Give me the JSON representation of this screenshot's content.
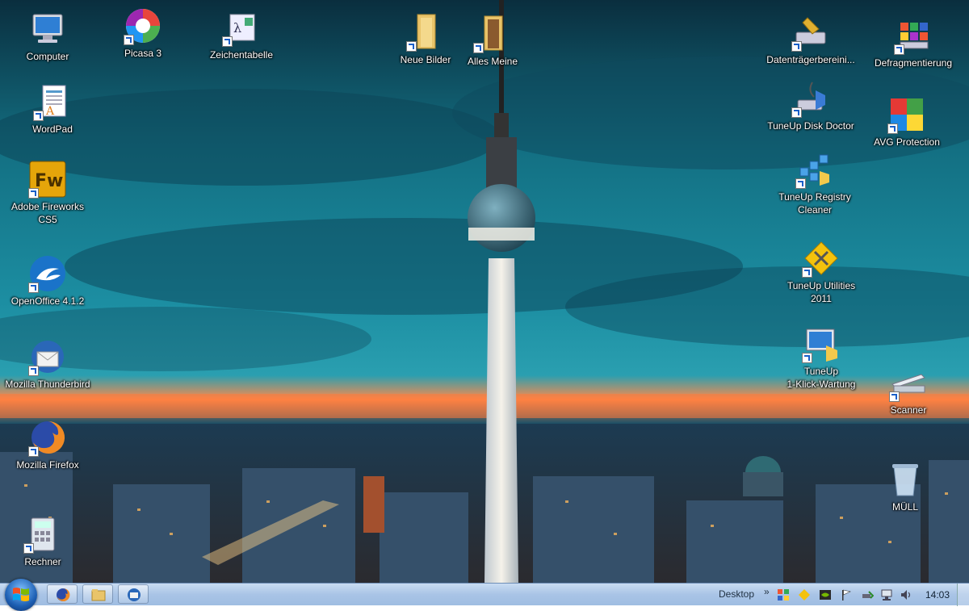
{
  "desktop": {
    "icons": [
      {
        "id": "computer",
        "label": "Computer"
      },
      {
        "id": "picasa",
        "label": "Picasa 3"
      },
      {
        "id": "zeichentabelle",
        "label": "Zeichentabelle"
      },
      {
        "id": "neue-bilder",
        "label": "Neue Bilder"
      },
      {
        "id": "alles-meine",
        "label": "Alles Meine"
      },
      {
        "id": "datentraeger",
        "label": "Datenträgerbereini..."
      },
      {
        "id": "defrag",
        "label": "Defragmentierung"
      },
      {
        "id": "wordpad",
        "label": "WordPad"
      },
      {
        "id": "fireworks",
        "label": "Adobe Fireworks\nCS5"
      },
      {
        "id": "openoffice",
        "label": "OpenOffice 4.1.2"
      },
      {
        "id": "thunderbird",
        "label": "Mozilla Thunderbird"
      },
      {
        "id": "firefox",
        "label": "Mozilla Firefox"
      },
      {
        "id": "rechner",
        "label": "Rechner"
      },
      {
        "id": "tuneup-disk",
        "label": "TuneUp Disk Doctor"
      },
      {
        "id": "avg",
        "label": "AVG Protection"
      },
      {
        "id": "tuneup-registry",
        "label": "TuneUp Registry\nCleaner"
      },
      {
        "id": "tuneup-utilities",
        "label": "TuneUp Utilities\n2011"
      },
      {
        "id": "tuneup-1klick",
        "label": "TuneUp\n1-Klick-Wartung"
      },
      {
        "id": "scanner",
        "label": "Scanner"
      },
      {
        "id": "muell",
        "label": "MÜLL"
      }
    ]
  },
  "taskbar": {
    "toolbar_label": "Desktop",
    "toolbar_chevron": "»",
    "clock": "14:03",
    "pinned": [
      "firefox-icon",
      "explorer-icon",
      "thunderbird-icon"
    ]
  },
  "colors": {
    "sky_top": "#0c3a4a",
    "sky_mid": "#1f8fa3",
    "sunset": "#ff7a3c",
    "taskbar": "#a9c4e6"
  }
}
